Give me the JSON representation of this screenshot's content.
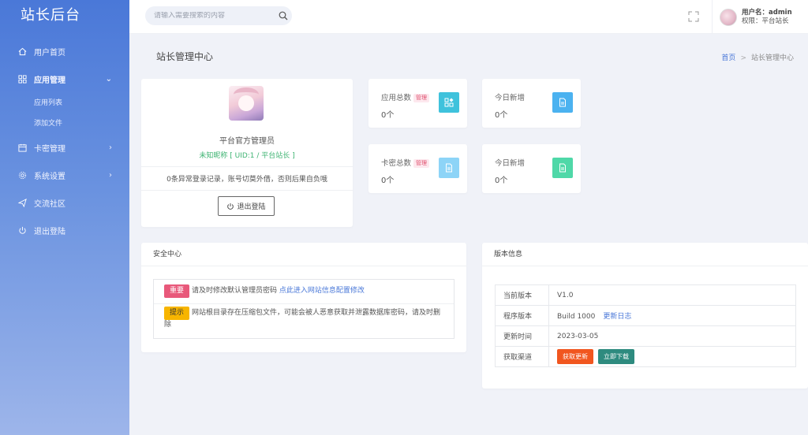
{
  "sidebar": {
    "brand": "站长后台",
    "items": [
      {
        "label": "用户首页"
      },
      {
        "label": "应用管理"
      },
      {
        "label": "卡密管理"
      },
      {
        "label": "系统设置"
      },
      {
        "label": "交流社区"
      },
      {
        "label": "退出登陆"
      }
    ],
    "sub_items": [
      {
        "label": "应用列表"
      },
      {
        "label": "添加文件"
      }
    ]
  },
  "header": {
    "search_placeholder": "请输入需要搜索的内容",
    "username": "用户名：admin",
    "role": "权限：平台站长"
  },
  "page": {
    "title": "站长管理中心",
    "breadcrumb_home": "首页",
    "breadcrumb_current": "站长管理中心"
  },
  "profile": {
    "name": "平台官方管理员",
    "subtitle": "未知昵称 [ UID:1 / 平台站长 ]",
    "message": "0条异常登录记录，账号切莫外借，否则后果自负哦",
    "logout_label": "退出登陆"
  },
  "stats": [
    {
      "label": "应用总数",
      "badge": "管理",
      "value": "0个"
    },
    {
      "label": "今日新增",
      "value": "0个"
    },
    {
      "label": "卡密总数",
      "badge": "管理",
      "value": "0个"
    },
    {
      "label": "今日新增",
      "value": "0个"
    }
  ],
  "security": {
    "title": "安全中心",
    "notice1_tag": "重要",
    "notice1_text": "请及时修改默认管理员密码",
    "notice1_link": "点此进入网站信息配置修改",
    "notice2_tag": "提示",
    "notice2_text": "网站根目录存在压缩包文件，可能会被人恶意获取并泄露数据库密码，请及时删除"
  },
  "version": {
    "title": "版本信息",
    "rows": [
      {
        "key": "当前版本",
        "value": "V1.0"
      },
      {
        "key": "程序版本",
        "value": "Build 1000",
        "link": "更新日志"
      },
      {
        "key": "更新时间",
        "value": "2023-03-05"
      },
      {
        "key": "获取渠道",
        "btn1": "获取更新",
        "btn2": "立即下载"
      }
    ]
  },
  "colors": {
    "sidebar_top": "#4a78d8",
    "sidebar_bottom": "#9db5ea",
    "accent_link": "#4a78d8",
    "success_text": "#3cb371",
    "tag_important": "#e8587a",
    "tag_tip": "#f7b500",
    "btn_update": "#f1561f",
    "btn_download": "#2e8b7f"
  }
}
